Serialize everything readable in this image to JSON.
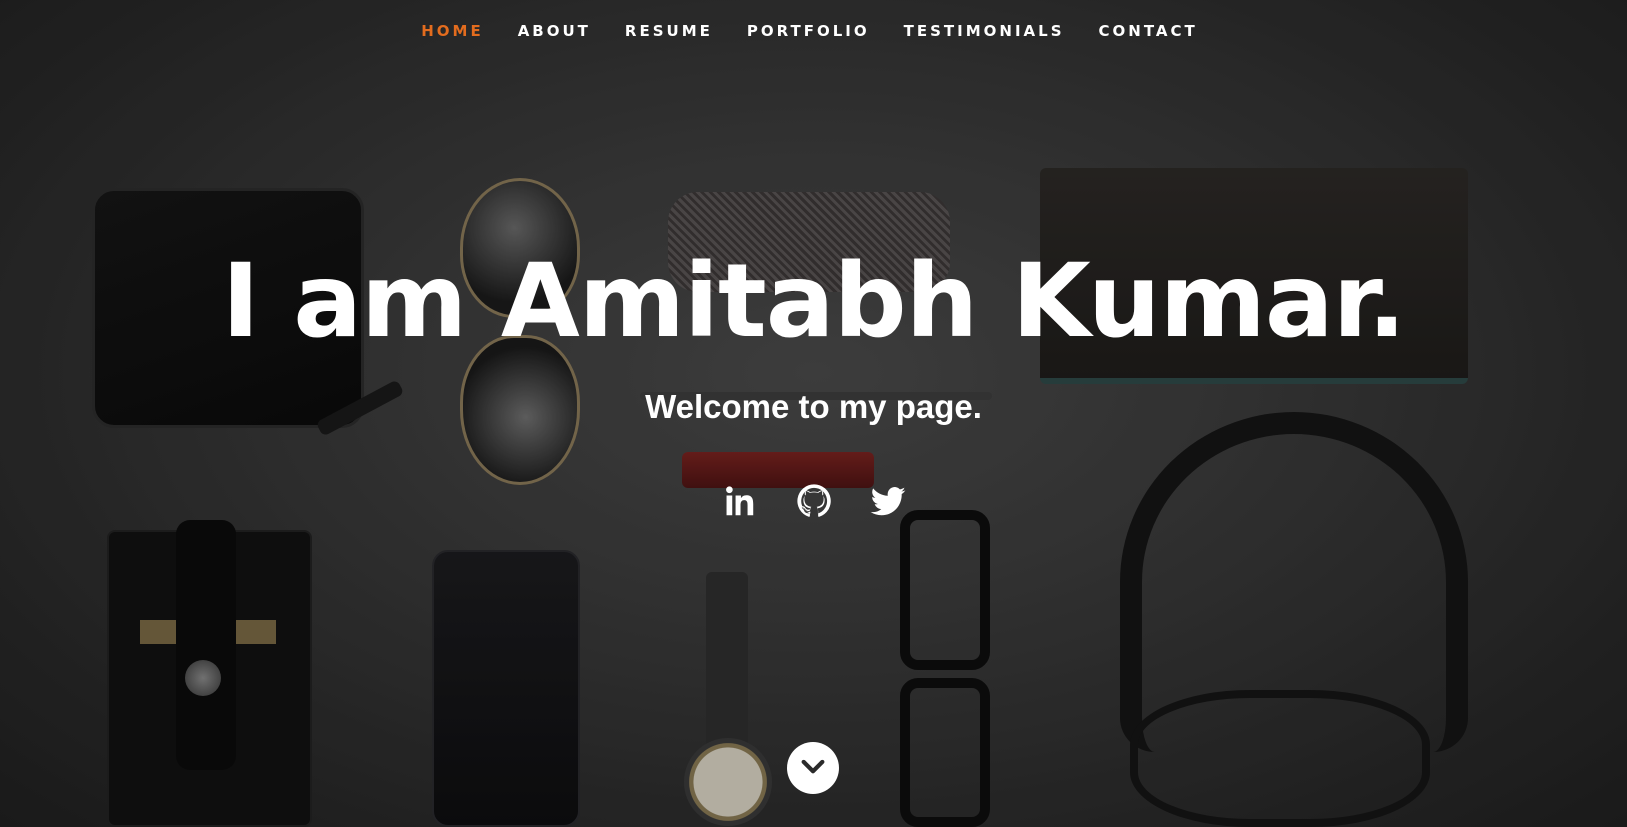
{
  "nav": {
    "items": [
      {
        "label": "HOME",
        "active": true
      },
      {
        "label": "ABOUT",
        "active": false
      },
      {
        "label": "RESUME",
        "active": false
      },
      {
        "label": "PORTFOLIO",
        "active": false
      },
      {
        "label": "TESTIMONIALS",
        "active": false
      },
      {
        "label": "CONTACT",
        "active": false
      }
    ],
    "active_color": "#e36c1e"
  },
  "banner": {
    "headline": "I am Amitabh Kumar.",
    "subline": "Welcome to my page."
  },
  "social": {
    "icons": [
      "linkedin-icon",
      "github-icon",
      "twitter-icon"
    ]
  },
  "scroll": {
    "icon": "chevron-down-icon"
  }
}
